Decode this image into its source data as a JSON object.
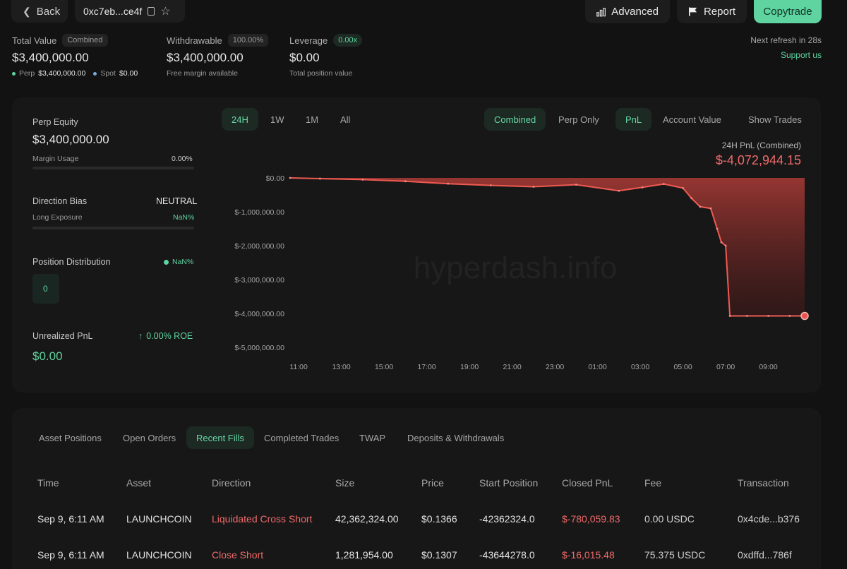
{
  "header": {
    "back_label": "Back",
    "address": "0xc7eb...ce4f",
    "advanced_label": "Advanced",
    "report_label": "Report",
    "copytrade_label": "Copytrade"
  },
  "summary": {
    "total_value_label": "Total Value",
    "total_value_badge": "Combined",
    "total_value": "$3,400,000.00",
    "perp_label": "Perp",
    "perp_value": "$3,400,000.00",
    "spot_label": "Spot",
    "spot_value": "$0.00",
    "withdrawable_label": "Withdrawable",
    "withdrawable_badge": "100.00%",
    "withdrawable_value": "$3,400,000.00",
    "withdrawable_sub": "Free margin available",
    "leverage_label": "Leverage",
    "leverage_badge": "0.00x",
    "leverage_value": "$0.00",
    "leverage_sub": "Total position value",
    "refresh_text": "Next refresh in 28s",
    "support_label": "Support us"
  },
  "left_panel": {
    "perp_equity_label": "Perp Equity",
    "perp_equity_value": "$3,400,000.00",
    "margin_usage_label": "Margin Usage",
    "margin_usage_value": "0.00%",
    "margin_usage_fraction": 0,
    "direction_bias_label": "Direction Bias",
    "direction_bias_value": "NEUTRAL",
    "long_exposure_label": "Long Exposure",
    "long_exposure_value": "NaN%",
    "position_distribution_label": "Position Distribution",
    "position_distribution_value": "NaN%",
    "position_count": "0",
    "unrealized_pnl_label": "Unrealized PnL",
    "roe_value": "0.00% ROE",
    "unrealized_pnl_value": "$0.00"
  },
  "chart_controls": {
    "ranges": [
      "24H",
      "1W",
      "1M",
      "All"
    ],
    "active_range": "24H",
    "mode_combined": "Combined",
    "mode_perp_only": "Perp Only",
    "metric_pnl": "PnL",
    "metric_account_value": "Account Value",
    "show_trades_label": "Show Trades",
    "pnl_caption": "24H PnL (Combined)",
    "pnl_value": "$-4,072,944.15",
    "watermark": "hyperdash.info"
  },
  "chart_data": {
    "type": "area",
    "title": "",
    "xlabel": "",
    "ylabel": "",
    "x_ticks": [
      "11:00",
      "13:00",
      "15:00",
      "17:00",
      "19:00",
      "21:00",
      "23:00",
      "01:00",
      "03:00",
      "05:00",
      "07:00",
      "09:00"
    ],
    "y_ticks": [
      "$0.00",
      "$-1,000,000.00",
      "$-2,000,000.00",
      "$-3,000,000.00",
      "$-4,000,000.00",
      "$-5,000,000.00"
    ],
    "ylim": [
      -5000000,
      0
    ],
    "xlim": [
      10.6,
      34.7
    ],
    "grid": false,
    "legend": "none",
    "color": "#e8544f",
    "series": [
      {
        "x": [
          10.6,
          12.0,
          14.0,
          16.0,
          18.0,
          20.0,
          22.0,
          24.0,
          26.0,
          27.1,
          28.1,
          29.0,
          29.4,
          29.8,
          30.3,
          30.6,
          30.8,
          31.0,
          31.2,
          32.0,
          33.0,
          34.0,
          34.7
        ],
        "y": [
          0,
          -20000,
          -50000,
          -100000,
          -170000,
          -220000,
          -260000,
          -200000,
          -380000,
          -280000,
          -180000,
          -300000,
          -600000,
          -850000,
          -900000,
          -1500000,
          -1900000,
          -2000000,
          -4072944,
          -4072944,
          -4072944,
          -4072944,
          -4072944
        ]
      }
    ]
  },
  "table": {
    "tabs": [
      "Asset Positions",
      "Open Orders",
      "Recent Fills",
      "Completed Trades",
      "TWAP",
      "Deposits & Withdrawals"
    ],
    "active_tab": "Recent Fills",
    "columns": [
      "Time",
      "Asset",
      "Direction",
      "Size",
      "Price",
      "Start Position",
      "Closed PnL",
      "Fee",
      "Transaction"
    ],
    "rows": [
      [
        "Sep 9, 6:11 AM",
        "LAUNCHCOIN",
        "Liquidated Cross Short",
        "42,362,324.00",
        "$0.1366",
        "-42362324.0",
        "$-780,059.83",
        "0.00 USDC",
        "0x4cde...b376"
      ],
      [
        "Sep 9, 6:11 AM",
        "LAUNCHCOIN",
        "Close Short",
        "1,281,954.00",
        "$0.1307",
        "-43644278.0",
        "$-16,015.48",
        "75.375 USDC",
        "0xdffd...786f"
      ]
    ]
  },
  "colors": {
    "accent_green": "#5fd3a0",
    "negative_red": "#ef6a6a",
    "background": "#121212",
    "card": "#171717"
  }
}
